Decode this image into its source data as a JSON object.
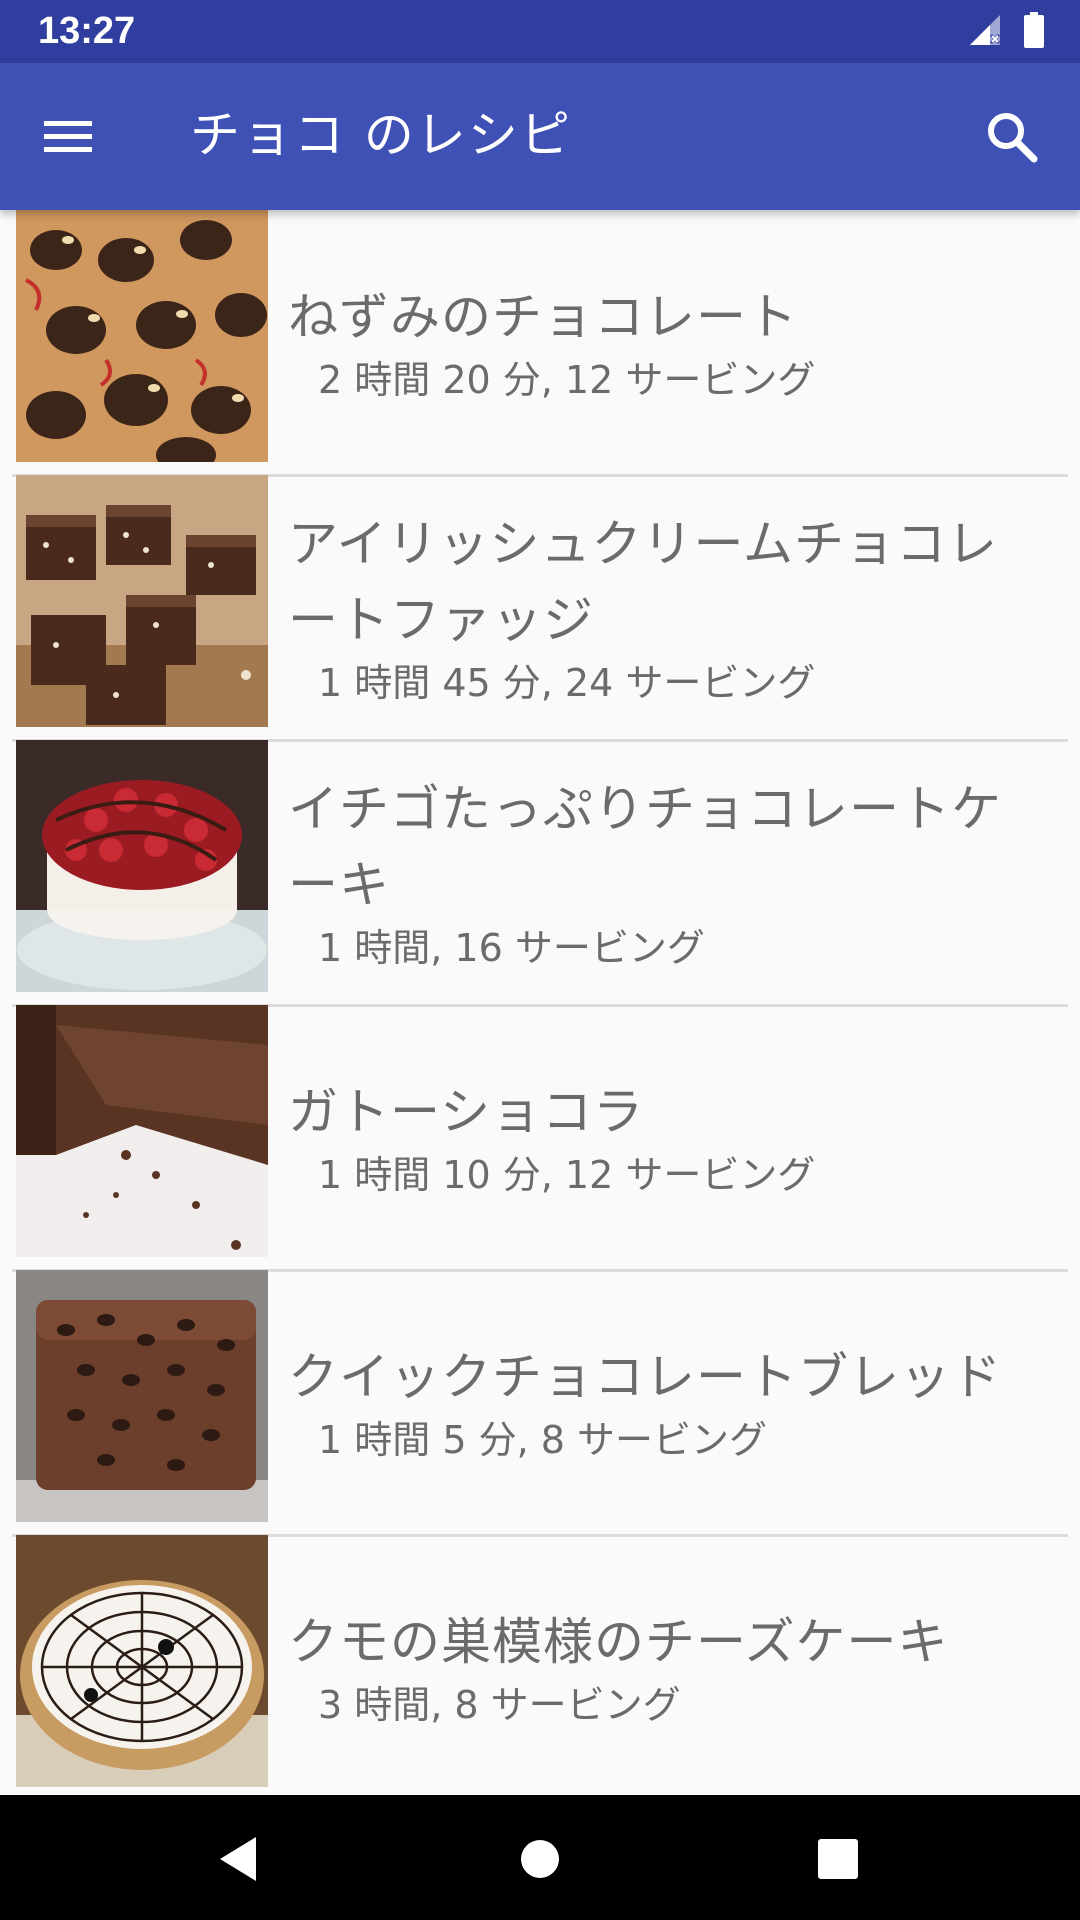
{
  "status_bar": {
    "time": "13:27",
    "icons": [
      "signal-no-data-icon",
      "battery-icon"
    ]
  },
  "app_bar": {
    "title": "チョコ のレシピ",
    "menu_icon": "menu-icon",
    "search_icon": "search-icon"
  },
  "recipes": [
    {
      "title": "ねずみのチョコレート",
      "meta": "2 時間 20 分, 12 サービング"
    },
    {
      "title": "アイリッシュクリームチョコレートファッジ",
      "meta": "1 時間 45 分, 24 サービング"
    },
    {
      "title": "イチゴたっぷりチョコレートケーキ",
      "meta": "1 時間, 16 サービング"
    },
    {
      "title": "ガトーショコラ",
      "meta": "1 時間 10 分, 12 サービング"
    },
    {
      "title": "クイックチョコレートブレッド",
      "meta": "1 時間 5 分, 8 サービング"
    },
    {
      "title": "クモの巣模様のチーズケーキ",
      "meta": "3 時間, 8 サービング"
    }
  ],
  "nav_bar": {
    "icons": [
      "back-icon",
      "home-icon",
      "recents-icon"
    ]
  },
  "colors": {
    "status_bar": "#303f9f",
    "app_bar": "#3f51b5",
    "text": "#6b6b6b"
  }
}
